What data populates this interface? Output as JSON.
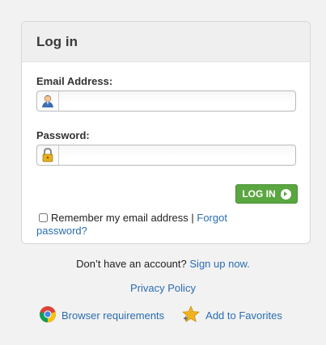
{
  "card": {
    "title": "Log in"
  },
  "email": {
    "label": "Email Address:",
    "value": "",
    "icon": "user-icon"
  },
  "password": {
    "label": "Password:",
    "value": "",
    "icon": "lock-icon"
  },
  "login_button": {
    "label": "LOG IN",
    "color": "#5aa640"
  },
  "remember": {
    "checked": false,
    "label": "Remember my email address |",
    "forgot_link": "Forgot password?"
  },
  "signup": {
    "prefix": "Don’t have an account?",
    "link": "Sign up now."
  },
  "privacy_link": "Privacy Policy",
  "footer_links": [
    {
      "label": "Browser requirements",
      "icon": "chrome-icon"
    },
    {
      "label": "Add to Favorites",
      "icon": "star-icon"
    }
  ],
  "colors": {
    "link": "#2a6db0",
    "background": "#f2f2f2"
  }
}
